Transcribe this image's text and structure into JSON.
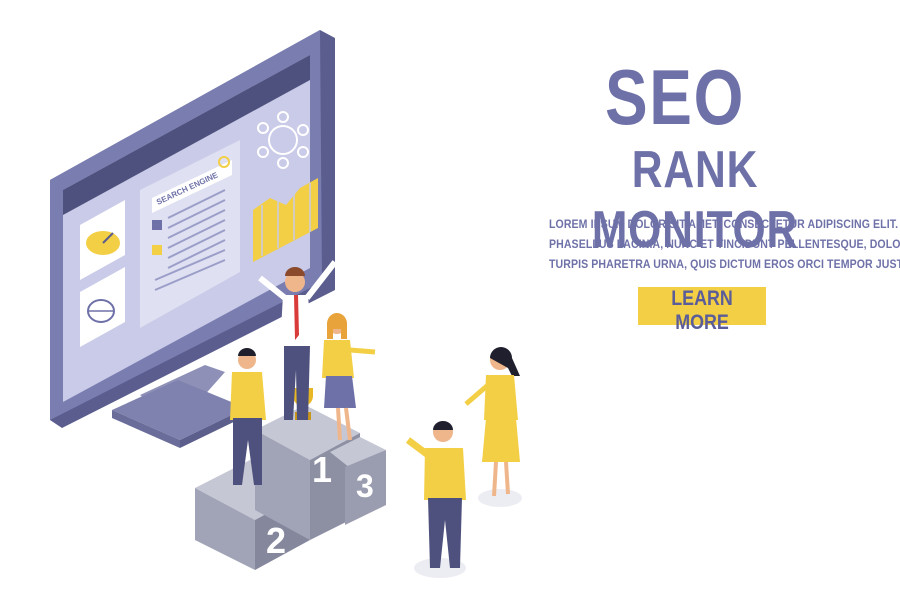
{
  "headline": {
    "line1": "SEO",
    "line2": "RANK MONITOR"
  },
  "body_text": [
    "LOREM IPSUM DOLOR SIT AMET, CONSECTETUR ADIPISCING ELIT.",
    "PHASELLUS LACINIA, NUNC ET TINCIDUNT PELLENTESQUE, DOLOR",
    "TURPIS PHARETRA URNA, QUIS DICTUM EROS ORCI TEMPOR JUSTO."
  ],
  "cta": {
    "label": "LEARN MORE"
  },
  "monitor": {
    "search_label": "SEARCH ENGINE"
  },
  "podium": {
    "places": [
      "1",
      "2",
      "3"
    ]
  },
  "colors": {
    "brand_purple": "#6e71a8",
    "light_purple": "#c9cbe8",
    "accent_yellow": "#f3cf45",
    "podium_gray": "#8d8fa3"
  }
}
